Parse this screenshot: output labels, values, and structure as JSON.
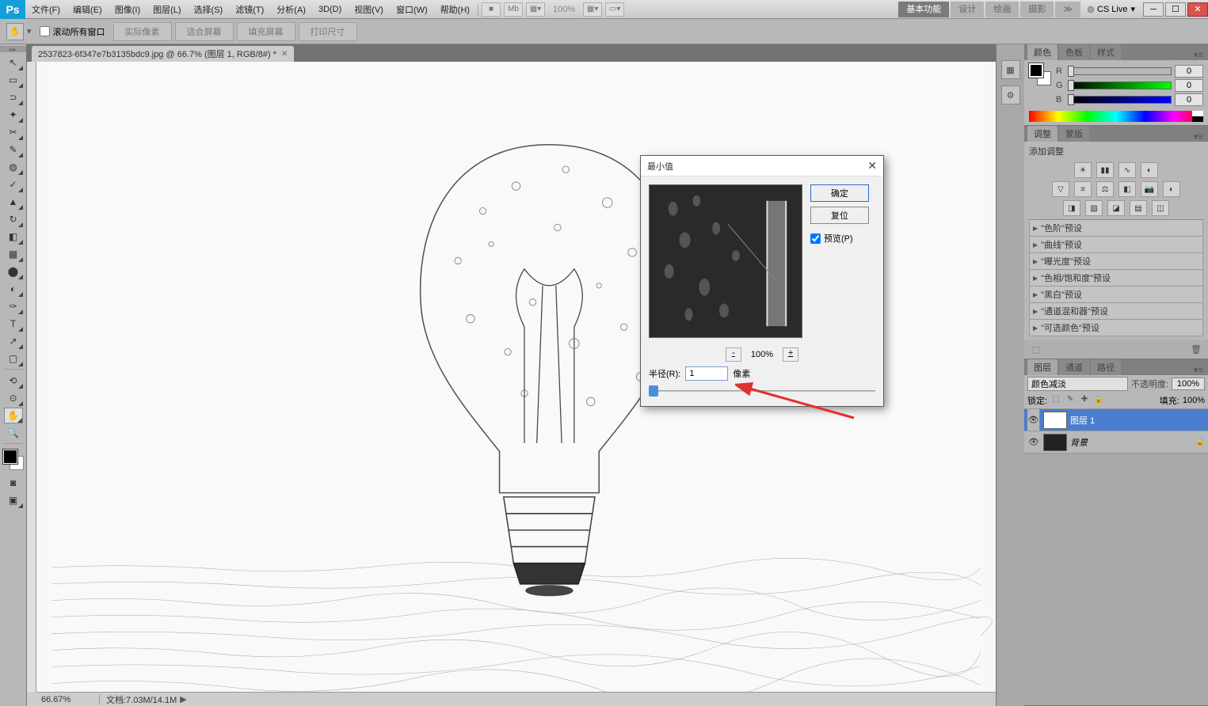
{
  "menubar": {
    "items": [
      "文件(F)",
      "编辑(E)",
      "图像(I)",
      "图层(L)",
      "选择(S)",
      "滤镜(T)",
      "分析(A)",
      "3D(D)",
      "视图(V)",
      "窗口(W)",
      "帮助(H)"
    ],
    "zoom_display": "100%",
    "workspaces": [
      "基本功能",
      "设计",
      "绘画",
      "摄影"
    ],
    "cslive": "CS Live"
  },
  "optbar": {
    "scroll_all_label": "滚动所有窗口",
    "buttons": [
      "实际像素",
      "适合屏幕",
      "填充屏幕",
      "打印尺寸"
    ]
  },
  "toolbox": {
    "tools": [
      "↖",
      "▭",
      "⊃",
      "✂",
      "✎",
      "◆",
      "⌷",
      "✓",
      "⊘",
      "△",
      "◐",
      "T",
      "↗"
    ]
  },
  "document": {
    "tab_title": "2537823-6f347e7b3135bdc9.jpg @ 66.7% (图层 1, RGB/8#) *",
    "status_zoom": "66.67%",
    "status_doc": "文档:7.03M/14.1M"
  },
  "panels": {
    "color": {
      "tabs": [
        "颜色",
        "色板",
        "样式"
      ],
      "channels": [
        {
          "label": "R",
          "value": "0",
          "gradient": "linear-gradient(90deg,#000,#f00)"
        },
        {
          "label": "G",
          "value": "0",
          "gradient": "linear-gradient(90deg,#000,#0f0)"
        },
        {
          "label": "B",
          "value": "0",
          "gradient": "linear-gradient(90deg,#000,#00f)"
        }
      ]
    },
    "adjust": {
      "tabs": [
        "调整",
        "蒙版"
      ],
      "title": "添加调整",
      "presets": [
        "\"色阶\"预设",
        "\"曲线\"预设",
        "\"曝光度\"预设",
        "\"色相/饱和度\"预设",
        "\"黑白\"预设",
        "\"通道混和器\"预设",
        "\"可选颜色\"预设"
      ]
    },
    "layers": {
      "tabs": [
        "图层",
        "通道",
        "路径"
      ],
      "blend_mode": "颜色减淡",
      "opacity_label": "不透明度:",
      "opacity_value": "100%",
      "lock_label": "锁定:",
      "fill_label": "填充:",
      "fill_value": "100%",
      "rows": [
        {
          "name": "图层 1",
          "selected": true,
          "thumb": "light"
        },
        {
          "name": "背景",
          "selected": false,
          "thumb": "dark",
          "locked": true
        }
      ]
    }
  },
  "dialog": {
    "title": "最小值",
    "ok": "确定",
    "reset": "复位",
    "preview_label": "预览(P)",
    "zoom_pct": "100%",
    "radius_label": "半径(R):",
    "radius_value": "1",
    "radius_unit": "像素"
  }
}
